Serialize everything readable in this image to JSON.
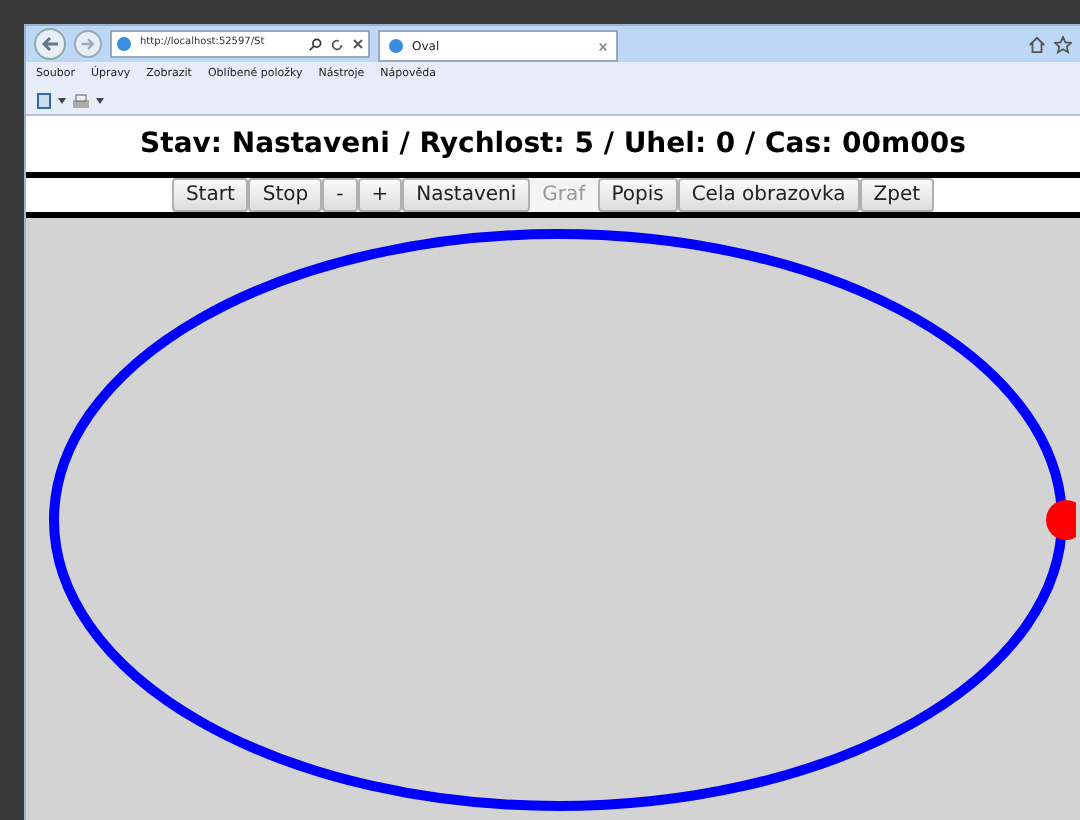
{
  "browser": {
    "address": "http://localhost:52597/St",
    "tab_title": "Oval",
    "menu": [
      "Soubor",
      "Úpravy",
      "Zobrazit",
      "Oblíbené položky",
      "Nástroje",
      "Nápověda"
    ]
  },
  "status": "Stav: Nastaveni / Rychlost: 5 / Uhel: 0 / Cas: 00m00s",
  "buttons": [
    {
      "label": "Start",
      "disabled": false
    },
    {
      "label": "Stop",
      "disabled": false
    },
    {
      "label": "-",
      "disabled": false
    },
    {
      "label": "+",
      "disabled": false
    },
    {
      "label": "Nastaveni",
      "disabled": false
    },
    {
      "label": "Graf",
      "disabled": true
    },
    {
      "label": "Popis",
      "disabled": false
    },
    {
      "label": "Cela obrazovka",
      "disabled": false
    },
    {
      "label": "Zpet",
      "disabled": false
    }
  ]
}
